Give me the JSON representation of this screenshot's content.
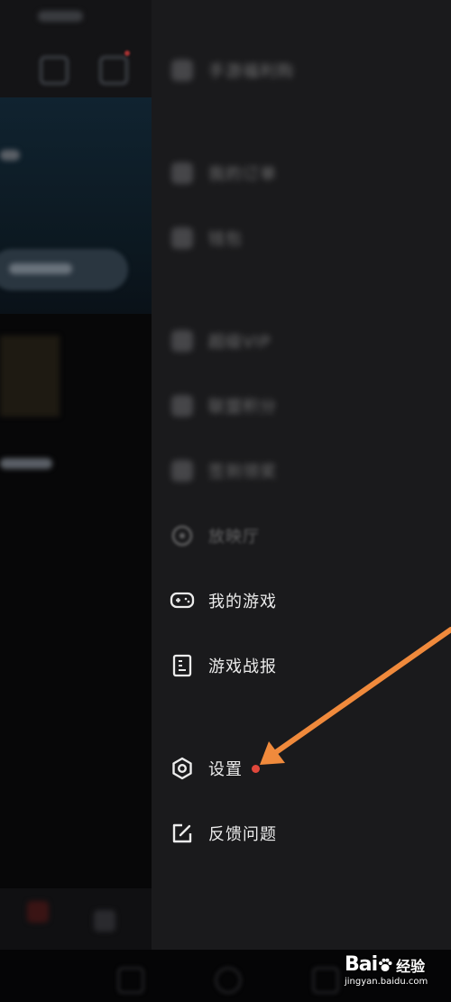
{
  "drawer": {
    "blurred_items": [
      {
        "label": "手游福利购",
        "icon": "gift-icon"
      },
      {
        "label": "我的订单",
        "icon": "order-icon"
      },
      {
        "label": "钱包",
        "icon": "wallet-icon"
      },
      {
        "label": "超级VIP",
        "icon": "vip-icon"
      },
      {
        "label": "联盟积分",
        "icon": "points-icon"
      },
      {
        "label": "签到领奖",
        "icon": "checkin-icon"
      }
    ],
    "partial_item": {
      "label": "放映厅",
      "icon": "cinema-icon"
    },
    "my_games": {
      "label": "我的游戏",
      "icon": "gamepad-icon"
    },
    "game_report": {
      "label": "游戏战报",
      "icon": "report-icon"
    },
    "settings": {
      "label": "设置",
      "icon": "settings-icon",
      "badge_color": "#e0473b"
    },
    "feedback": {
      "label": "反馈问题",
      "icon": "edit-icon"
    }
  },
  "annotation": {
    "arrow_color": "#f08a3c"
  },
  "watermark": {
    "brand_cn": "经验",
    "url": "jingyan.baidu.com"
  },
  "colors": {
    "drawer_bg": "#1a1a1c",
    "text": "#ececec",
    "badge": "#e0473b"
  }
}
